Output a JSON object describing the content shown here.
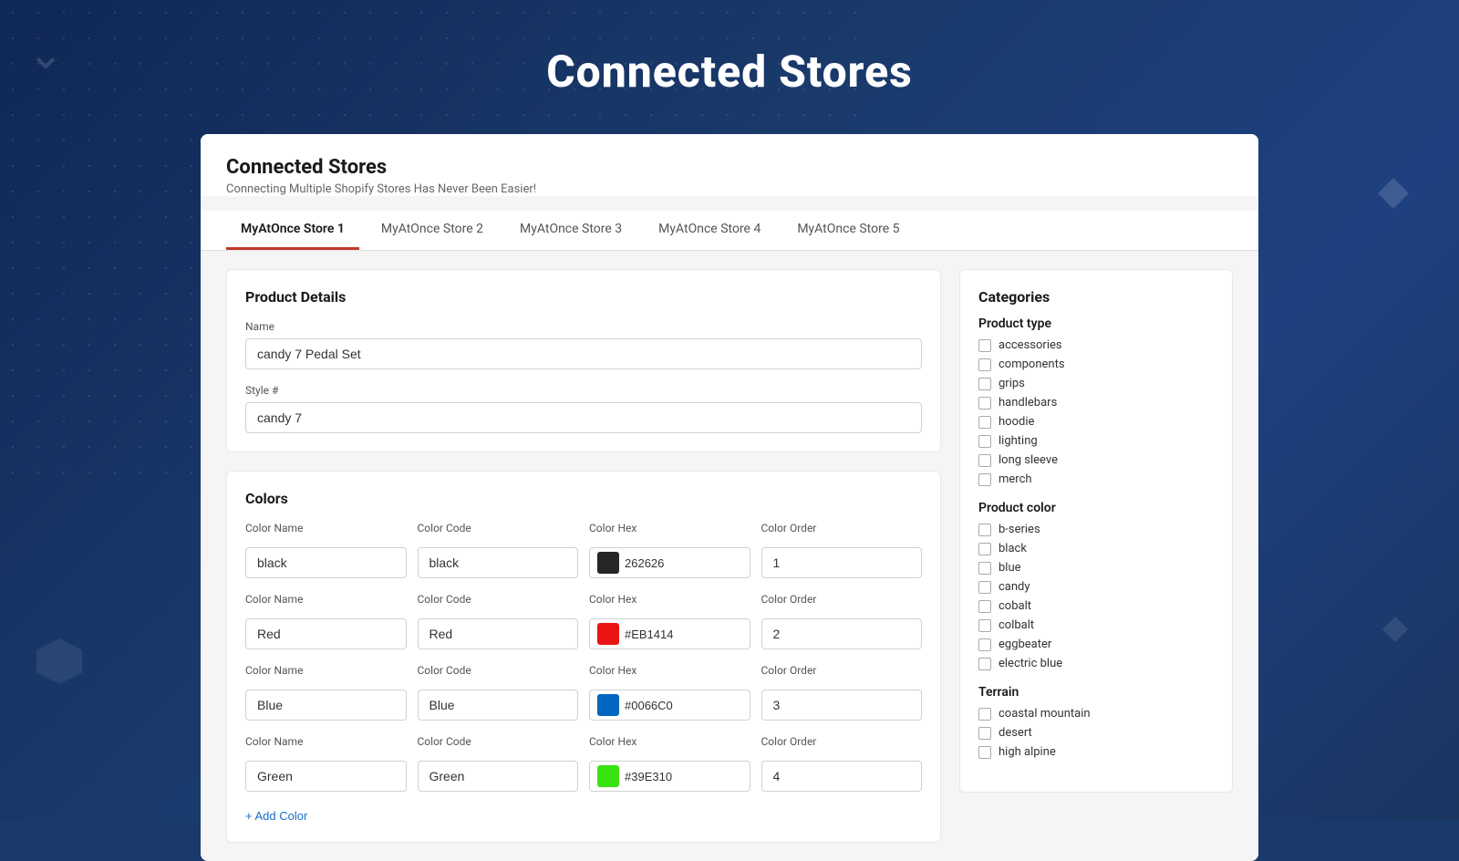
{
  "page": {
    "title": "Connected Stores",
    "background_accent": "#1a3a6b"
  },
  "header": {
    "title": "Connected Stores",
    "subtitle": "Connecting Multiple Shopify Stores Has Never Been Easier!"
  },
  "tabs": [
    {
      "label": "MyAtOnce Store 1",
      "active": true
    },
    {
      "label": "MyAtOnce Store 2",
      "active": false
    },
    {
      "label": "MyAtOnce Store 3",
      "active": false
    },
    {
      "label": "MyAtOnce Store 4",
      "active": false
    },
    {
      "label": "MyAtOnce Store 5",
      "active": false
    }
  ],
  "product_details": {
    "section_title": "Product Details",
    "name_label": "Name",
    "name_value": "candy 7 Pedal Set",
    "style_label": "Style #",
    "style_value": "candy 7"
  },
  "colors": {
    "section_title": "Colors",
    "add_color_label": "+ Add Color",
    "column_labels": {
      "color_name": "Color Name",
      "color_code": "Color Code",
      "color_hex": "Color Hex",
      "color_order": "Color Order"
    },
    "rows": [
      {
        "name": "black",
        "code": "black",
        "hex": "262626",
        "hex_color": "#262626",
        "order": "1"
      },
      {
        "name": "Red",
        "code": "Red",
        "hex": "#EB1414",
        "hex_color": "#EB1414",
        "order": "2"
      },
      {
        "name": "Blue",
        "code": "Blue",
        "hex": "#0066C0",
        "hex_color": "#0066C0",
        "order": "3"
      },
      {
        "name": "Green",
        "code": "Green",
        "hex": "#39E310",
        "hex_color": "#39E310",
        "order": "4"
      }
    ]
  },
  "categories": {
    "title": "Categories",
    "groups": [
      {
        "group_title": "Product type",
        "items": [
          "accessories",
          "components",
          "grips",
          "handlebars",
          "hoodie",
          "lighting",
          "long sleeve",
          "merch"
        ]
      },
      {
        "group_title": "Product color",
        "items": [
          "b-series",
          "black",
          "blue",
          "candy",
          "cobalt",
          "colbalt",
          "eggbeater",
          "electric blue"
        ]
      },
      {
        "group_title": "Terrain",
        "items": [
          "coastal mountain",
          "desert",
          "high alpine"
        ]
      }
    ]
  }
}
